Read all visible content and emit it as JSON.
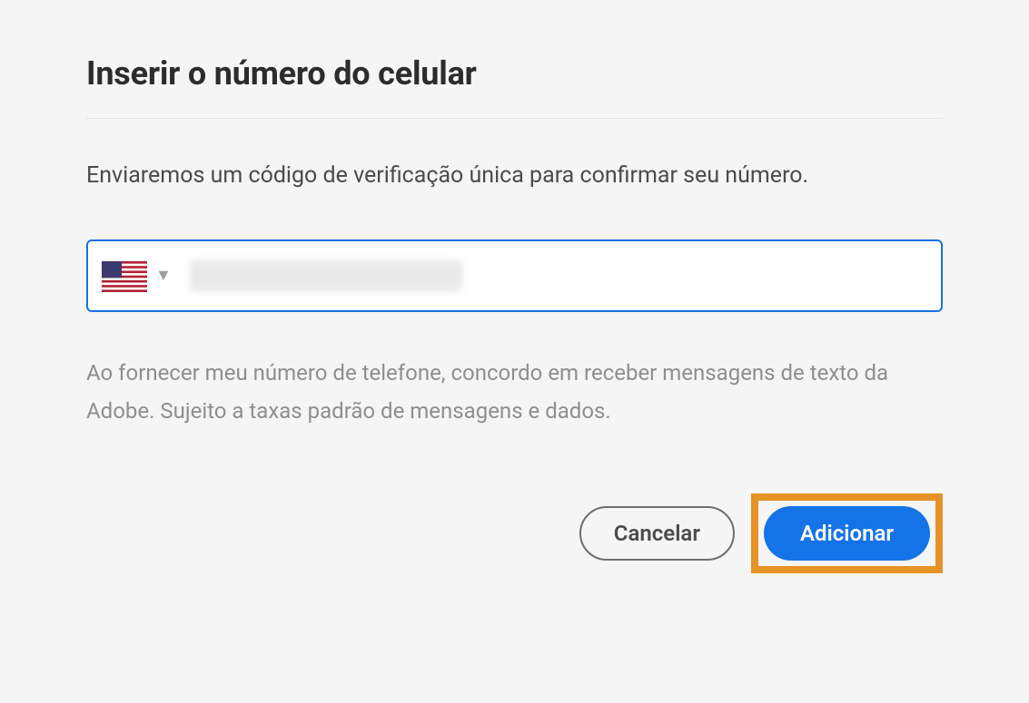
{
  "dialog": {
    "title": "Inserir o número do celular",
    "description": "Enviaremos um código de verificação única para confirmar seu número.",
    "disclaimer": "Ao fornecer meu número de telefone, concordo em receber mensagens de texto da Adobe. Sujeito a taxas padrão de mensagens e dados."
  },
  "phone": {
    "country_code": "US",
    "flag": "us",
    "value": ""
  },
  "buttons": {
    "cancel": "Cancelar",
    "add": "Adicionar"
  }
}
